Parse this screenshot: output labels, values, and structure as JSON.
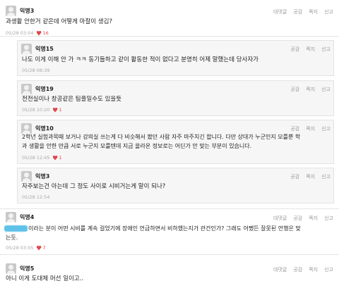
{
  "actions": {
    "reply": "대댓글",
    "like": "공감",
    "message": "쪽지",
    "report": "신고"
  },
  "c1": {
    "nick": "익명3",
    "text": "과생활 안한거 같은데 어떻게 마찰이 생김?",
    "time": "05/28 03:04",
    "likes": "16"
  },
  "r1": {
    "nick": "익명15",
    "text": "나도 이게 이해 안 가 ㅋㅋ 동기들하고 같이 활동한 적이 없다고 분명히 어제 말했는데 당사자가",
    "time": "05/28 08:39"
  },
  "r2": {
    "nick": "익명19",
    "text": "전전실이나 창공같은 팀플일수도 있을듯",
    "time": "05/28 10:20",
    "likes": "1"
  },
  "r3": {
    "nick": "익명10",
    "text1": "2학년 실험과목때 보거나 강의실 쓰는게 다 비슷해서 봤던 사람 자주 마주치긴 합니다. 다만 상대가 누군인지 모를뿐 학",
    "text2": "과 생활을 안한 만큼 서로 누군지 모를텐데 지금 올라온 정보로는 어딘가 안 맞는 부분이 있습니다.",
    "time": "05/28 12:45",
    "likes": "1"
  },
  "r4": {
    "nick": "익명3",
    "text": "자주보는건 아는데 그 정도 사이로 시비거는게 말이 되나?",
    "time": "05/28 12:54"
  },
  "c2": {
    "nick": "익명4",
    "text1": "이라는 분이 어떤 시비를 계속 걸었기에 장애인 언급하면서 비하했는지가 관건인가? 그래도 어쨌든 잘못된 언행은 맞",
    "text2": "는듯.",
    "time": "05/28 03:05",
    "likes": "7"
  },
  "c3": {
    "nick": "익명5",
    "text": "아니 이게 도대체 머선 일이고.."
  }
}
